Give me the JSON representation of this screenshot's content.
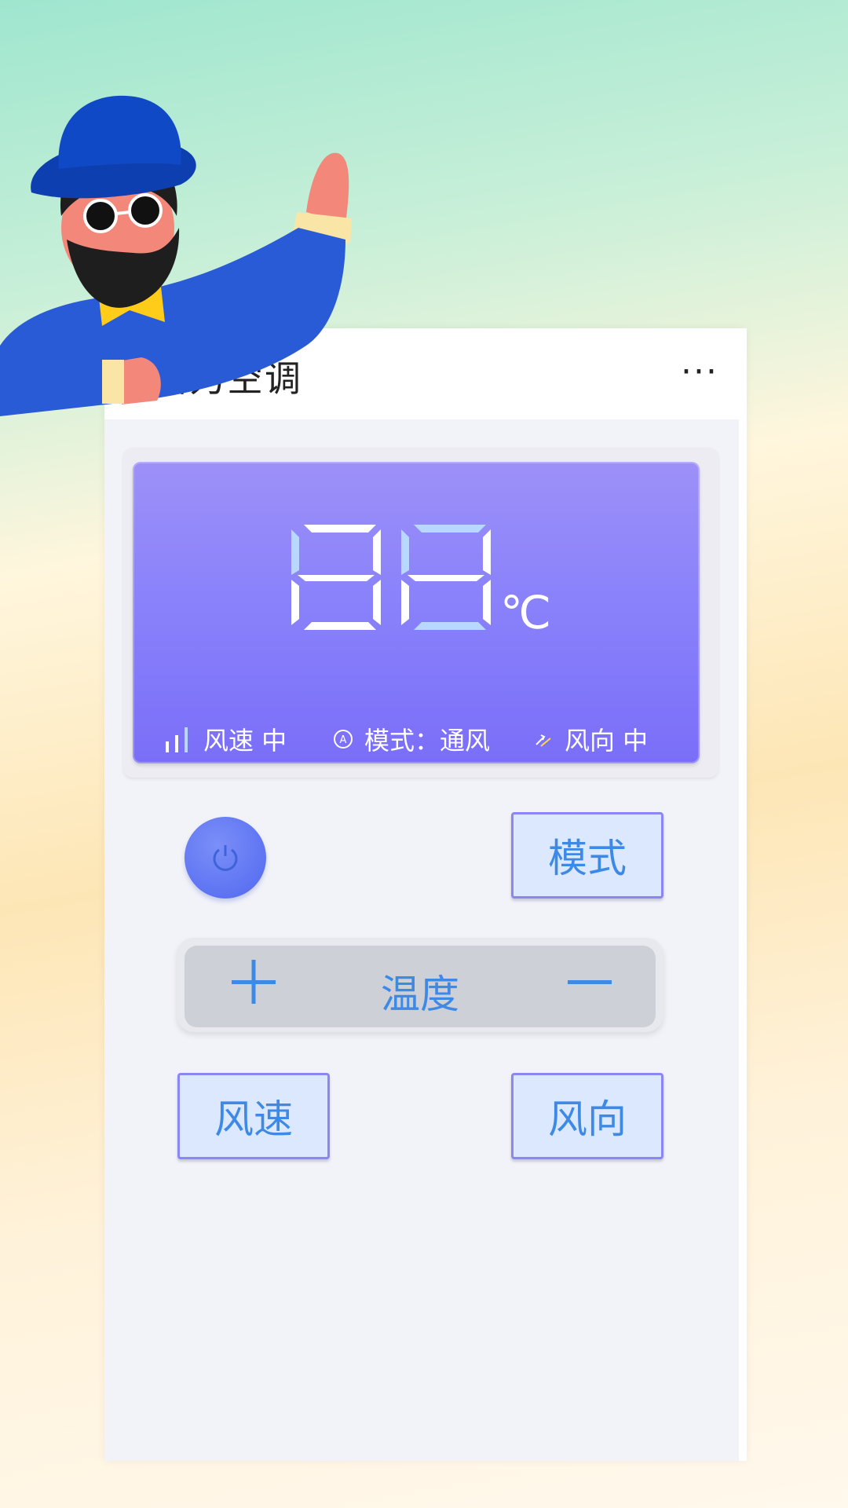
{
  "app": {
    "title": "格力空调",
    "more_label": "···"
  },
  "display": {
    "temperature_digits": "88",
    "unit": "℃",
    "fan_speed_label": "风速 中",
    "mode_label": "模式：通风",
    "direction_label": "风向 中"
  },
  "controls": {
    "mode_button": "模式",
    "temperature_label": "温度",
    "fan_speed_button": "风速",
    "direction_button": "风向"
  },
  "colors": {
    "accent_text": "#3d8ae6",
    "lcd_purple": "#8a82fb",
    "button_fill": "#dbe8fd",
    "button_border": "#8a86f2",
    "power_blue": "#5d73f2"
  },
  "icons": {
    "signal": "signal-bars-icon",
    "mode": "auto-mode-icon",
    "direction": "swing-direction-icon",
    "power": "power-icon",
    "plus": "plus-icon",
    "minus": "minus-icon"
  }
}
